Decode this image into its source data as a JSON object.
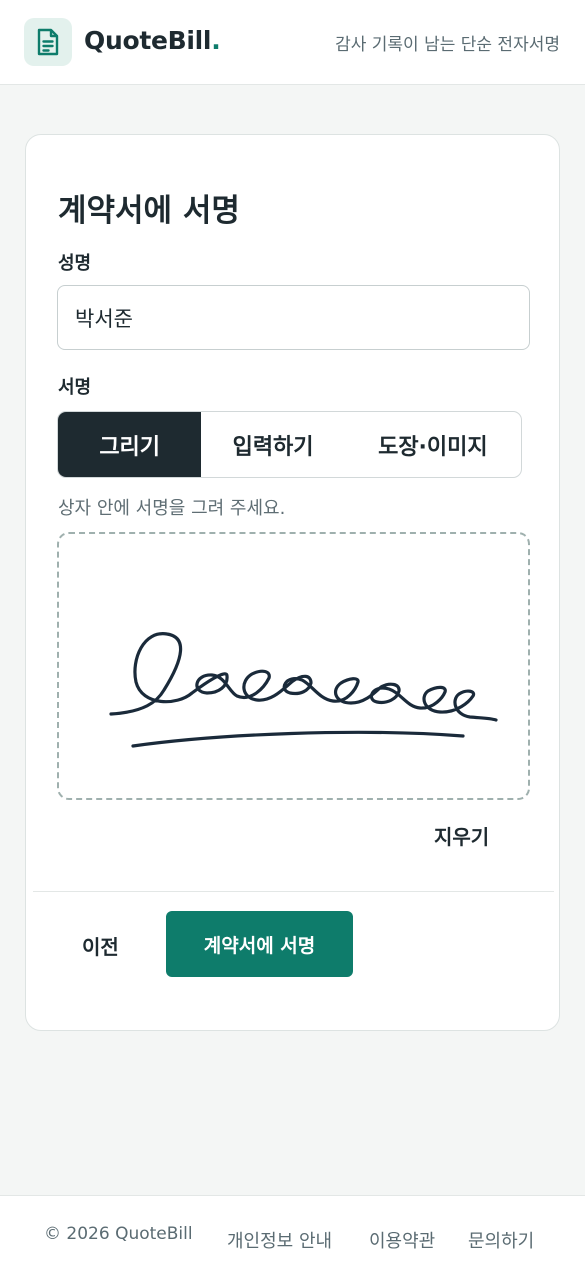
{
  "header": {
    "logo_icon": "document-icon",
    "brand_name": "QuoteBill",
    "brand_dot": ".",
    "tagline": "감사 기록이 남는 단순 전자서명"
  },
  "form": {
    "title": "계약서에 서명",
    "name_label": "성명",
    "name_value": "박서준",
    "signature_label": "서명",
    "tabs": [
      {
        "label": "그리기",
        "active": true
      },
      {
        "label": "입력하기",
        "active": false
      },
      {
        "label": "도장·이미지",
        "active": false
      }
    ],
    "hint": "상자 안에 서명을 그려 주세요.",
    "clear_label": "지우기",
    "prev_label": "이전",
    "submit_label": "계약서에 서명"
  },
  "footer": {
    "copyright": "© 2026 QuoteBill",
    "links": [
      "개인정보 안내",
      "이용약관",
      "문의하기"
    ]
  },
  "colors": {
    "accent": "#0e7c6b",
    "dark": "#1e2a30",
    "logo_bg": "#e3f1ed"
  }
}
